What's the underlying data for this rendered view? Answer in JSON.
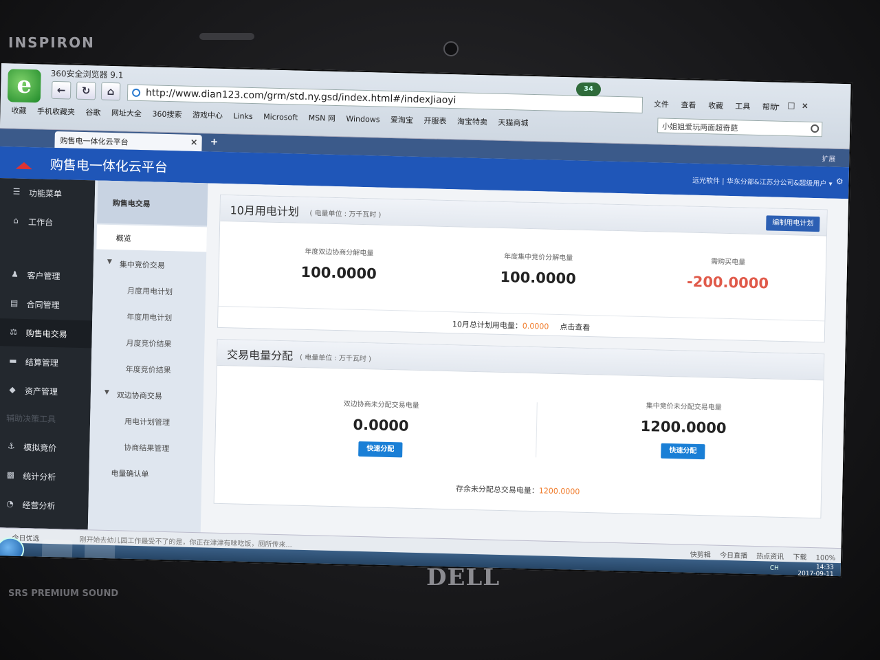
{
  "laptop": {
    "brand_top": "INSPIRON",
    "brand_bottom": "DELL",
    "sound_logo": "SRS PREMIUM SOUND",
    "led_badge": "34"
  },
  "browser": {
    "window_title": "360安全浏览器 9.1",
    "address": "http://www.dian123.com/grm/std.ny.gsd/index.html#/indexJiaoyi",
    "menu": [
      "文件",
      "查看",
      "收藏",
      "工具",
      "帮助"
    ],
    "search_placeholder": "小姐姐爱玩两面超奇葩",
    "bookmarks": [
      "收藏",
      "手机收藏夹",
      "谷歌",
      "网址大全",
      "360搜索",
      "游戏中心",
      "Links",
      "Microsoft",
      "MSN 网",
      "Windows",
      "爱淘宝",
      "开服表",
      "淘宝特卖",
      "天猫商城"
    ],
    "tab_label": "购售电一体化云平台",
    "tab_extension": "扩展"
  },
  "app": {
    "title": "购售电一体化云平台",
    "user_info": "远光软件 | 华东分部&江苏分公司&超级用户 ▾",
    "sidebar": [
      {
        "label": "功能菜单",
        "icon": "menu-icon"
      },
      {
        "label": "工作台",
        "icon": "home-icon"
      },
      {
        "label": "客户管理",
        "icon": "users-icon"
      },
      {
        "label": "合同管理",
        "icon": "contract-icon"
      },
      {
        "label": "购售电交易",
        "icon": "trade-icon"
      },
      {
        "label": "结算管理",
        "icon": "settlement-icon"
      },
      {
        "label": "资产管理",
        "icon": "asset-icon"
      },
      {
        "label": "辅助决策工具",
        "icon": ""
      },
      {
        "label": "模拟竞价",
        "icon": "anchor-icon"
      },
      {
        "label": "统计分析",
        "icon": "bar-chart-icon"
      },
      {
        "label": "经营分析",
        "icon": "pie-chart-icon"
      }
    ],
    "submenu": {
      "header": "购售电交易",
      "items": [
        "概览",
        "集中竞价交易",
        "月度用电计划",
        "年度用电计划",
        "月度竞价结果",
        "年度竞价结果",
        "双边协商交易",
        "用电计划管理",
        "协商结果管理",
        "电量确认单"
      ]
    },
    "plan_panel": {
      "title": "10月用电计划",
      "unit": "( 电量单位 : 万千瓦时 )",
      "edit_button": "编制用电计划",
      "stats": [
        {
          "label": "年度双边协商分解电量",
          "value": "100.0000"
        },
        {
          "label": "年度集中竞价分解电量",
          "value": "100.0000"
        },
        {
          "label": "需购买电量",
          "value": "-200.0000"
        }
      ],
      "total_label": "10月总计划用电量：",
      "total_value": "0.0000",
      "view_link": "点击查看"
    },
    "alloc_panel": {
      "title": "交易电量分配",
      "unit": "( 电量单位 : 万千瓦时 )",
      "stats": [
        {
          "label": "双边协商未分配交易电量",
          "value": "0.0000",
          "button": "快速分配"
        },
        {
          "label": "集中竞价未分配交易电量",
          "value": "1200.0000",
          "button": "快速分配"
        }
      ],
      "remain_label": "存余未分配总交易电量：",
      "remain_value": "1200.0000"
    }
  },
  "statusbar": {
    "left": "今日优选",
    "news": "刚开始去幼儿园工作最受不了的是，你正在津津有味吃饭，厕所传来...",
    "right": [
      "快剪辑",
      "今日直播",
      "热点资讯",
      "下载",
      "100%"
    ]
  },
  "taskbar": {
    "time": "14:33",
    "date": "2017-09-11",
    "tray": "CH"
  }
}
